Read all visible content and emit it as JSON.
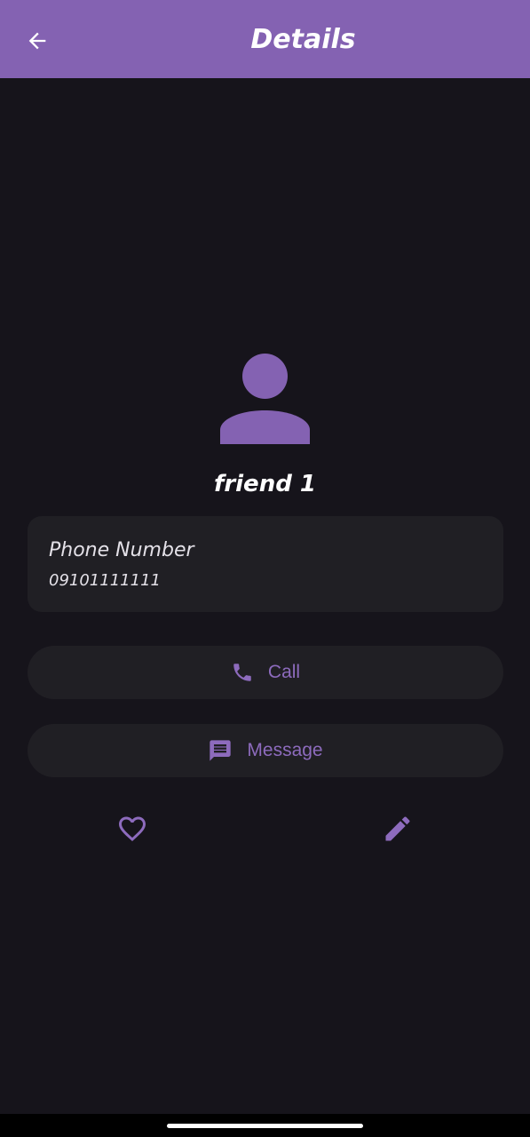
{
  "app_bar": {
    "title": "Details",
    "back_icon": "arrow-back-icon",
    "background_color": "#8462b2"
  },
  "contact": {
    "avatar_icon": "person-icon",
    "name": "friend 1"
  },
  "phone_card": {
    "label": "Phone Number",
    "value": "09101111111"
  },
  "actions": {
    "call": {
      "label": "Call",
      "icon": "phone-icon"
    },
    "message": {
      "label": "Message",
      "icon": "message-icon"
    },
    "favorite": {
      "icon": "heart-outline-icon"
    },
    "edit": {
      "icon": "pencil-icon"
    }
  },
  "theme": {
    "background": "#16141b",
    "surface": "#201f24",
    "accent": "#8d6bbd"
  }
}
